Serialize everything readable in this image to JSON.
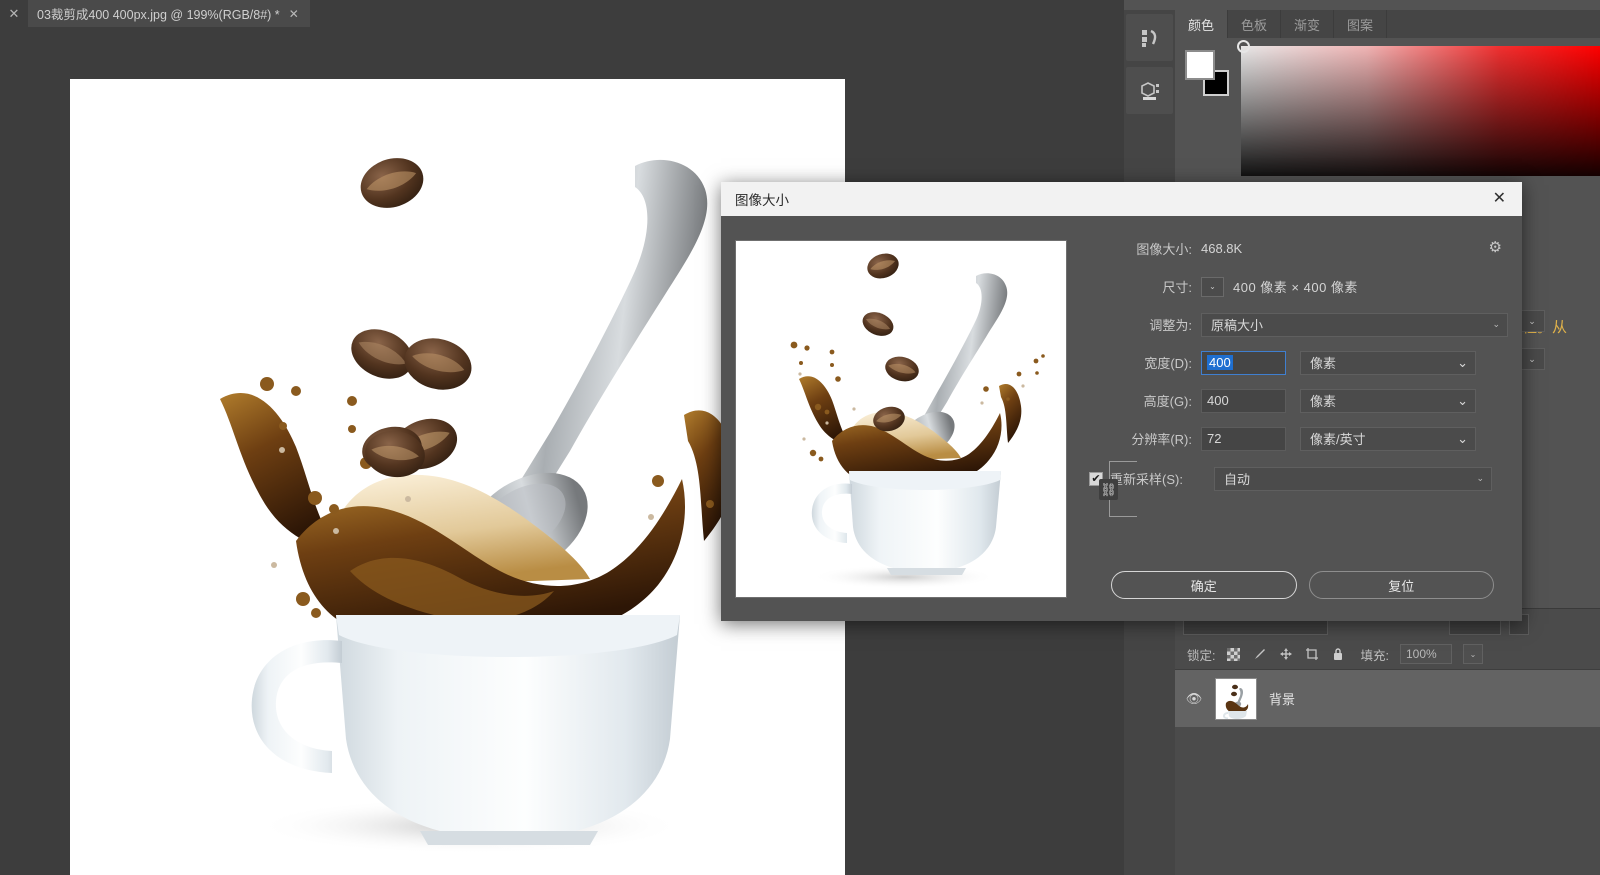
{
  "window": {
    "tab_close_left": "✕",
    "document_tab": {
      "title": "03裁剪成400 400px.jpg @ 199%(RGB/8#) *",
      "close": "✕"
    }
  },
  "right_dock": {
    "panel_tabs": [
      {
        "label": "颜色",
        "active": true
      },
      {
        "label": "色板",
        "active": false
      },
      {
        "label": "渐变",
        "active": false
      },
      {
        "label": "图案",
        "active": false
      }
    ],
    "note_text": "程。从"
  },
  "layers_panel": {
    "lock_label": "锁定:",
    "lock_icons": [
      "checker-icon",
      "brush-icon",
      "move-icon",
      "artboard-icon",
      "lock-icon"
    ],
    "fill_label": "填充:",
    "fill_value": "100%",
    "rows": [
      {
        "visible": "👁",
        "name": "背景"
      }
    ]
  },
  "dialog": {
    "title": "图像大小",
    "close": "✕",
    "gear": "⚙",
    "image_size_label": "图像大小:",
    "image_size_value": "468.8K",
    "dimensions_label": "尺寸:",
    "dimensions_value": "400 像素  ×  400 像素",
    "fit_to_label": "调整为:",
    "fit_to_value": "原稿大小",
    "width_label": "宽度(D):",
    "width_value": "400",
    "width_unit": "像素",
    "height_label": "高度(G):",
    "height_value": "400",
    "height_unit": "像素",
    "resolution_label": "分辨率(R):",
    "resolution_value": "72",
    "resolution_unit": "像素/英寸",
    "resample_label": "重新采样(S):",
    "resample_value": "自动",
    "resample_checked": "✔",
    "chain_glyph": "⛓",
    "ok_button": "确定",
    "reset_button": "复位"
  },
  "colors": {
    "app_bg": "#535353",
    "doc_bg": "#3d3d3d",
    "panel_bg": "#454545",
    "accent_blue": "#1f6fd0",
    "note_yellow": "#e0b24a",
    "foreground_swatch": "#ffffff",
    "background_swatch": "#000000"
  }
}
